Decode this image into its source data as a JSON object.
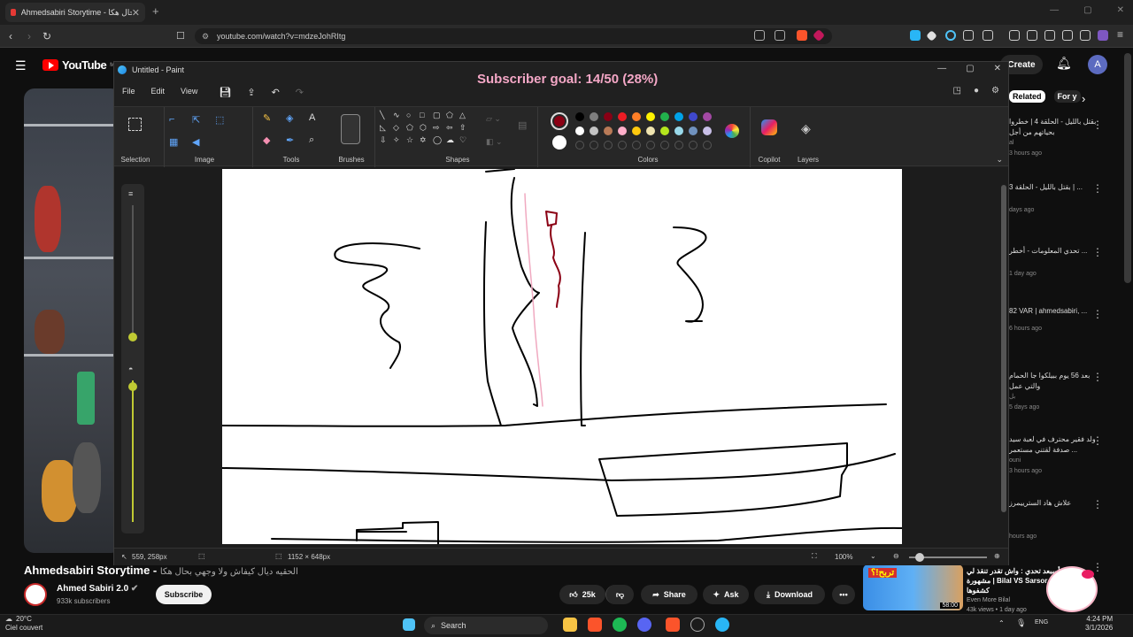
{
  "browser": {
    "tab_title": "Ahmedsabiri Storytime - الحقيه ديال كيفاش ولا وجهي بحال هكا",
    "tab_close": "✕",
    "new_tab": "+",
    "url": "youtube.com/watch?v=mdzeJohRItg",
    "window_controls": [
      "—",
      "▢",
      "✕"
    ]
  },
  "youtube": {
    "logo_text": "YouTube",
    "logo_region": "MA",
    "create_label": "Create",
    "avatar_letter": "A",
    "tabs": [
      "Related",
      "For y"
    ],
    "video_title": "Ahmedsabiri Storytime - ",
    "video_title_ar": "الحقيه ديال كيفاش ولا وجهي بحال هكا",
    "channel_name": "Ahmed Sabiri 2.0",
    "channel_subs": "933k subscribers",
    "subscribe_label": "Subscribe",
    "likes": "25k",
    "share_label": "Share",
    "ask_label": "Ask",
    "download_label": "Download",
    "more_label": "•••",
    "recommendations": [
      {
        "title": "بقتل بالليل - الحلقة 4 | خطروا بحياتهم من أجل",
        "channel": "al",
        "meta": "3 hours ago"
      },
      {
        "title": "بقتل بالليل - الحلقة 3 | ...",
        "channel": "",
        "meta": "days ago"
      },
      {
        "title": "تحدي المعلومات - أخطر ...",
        "channel": "",
        "meta": "1 day ago"
      },
      {
        "title": "82 VAR | ahmedsabiri, ...",
        "channel": "",
        "meta": "6 hours ago"
      },
      {
        "title": "بعد 56 يوم ببيلكوا جا الحمام والتي عمل",
        "channel": "بل",
        "meta": "5 days ago"
      },
      {
        "title": "ولد فقير محترف في لعبة سيد صدفة لقتني مستعمر ...",
        "channel": "ouni",
        "meta": "3 hours ago"
      },
      {
        "title": "علاش هاد السترييمرز",
        "channel": "",
        "meta": "hours ago"
      }
    ],
    "bottom_rec": {
      "title": "أسبعد تحدي : واش تقدر تنقذ لي مشهورة | Bilal VS Sarsor | كشفوها",
      "channel": "Even More Bilal",
      "meta": "43k views • 1 day ago",
      "duration": "58:00",
      "thumb_text": "تربح!؟"
    }
  },
  "paint": {
    "title": "Untitled - Paint",
    "overlay": "Subscriber goal: 14/50 (28%)",
    "menu": [
      "File",
      "Edit",
      "View"
    ],
    "groups": {
      "selection": "Selection",
      "image": "Image",
      "tools": "Tools",
      "brushes": "Brushes",
      "shapes": "Shapes",
      "colors": "Colors",
      "copilot": "Copilot",
      "layers": "Layers"
    },
    "cursor_pos": "559, 258px",
    "canvas_size": "1152 × 648px",
    "zoom": "100%",
    "primary_color": "#8b0014",
    "secondary_color": "#ffffff",
    "palette_row1": [
      "#000000",
      "#7f7f7f",
      "#880015",
      "#ed1c24",
      "#ff7f27",
      "#fff200",
      "#22b14c",
      "#00a2e8",
      "#3f48cc",
      "#a349a4"
    ],
    "palette_row2": [
      "#ffffff",
      "#c3c3c3",
      "#b97a57",
      "#ffaec9",
      "#ffc90e",
      "#efe4b0",
      "#b5e61d",
      "#99d9ea",
      "#7092be",
      "#c8bfe7"
    ]
  },
  "taskbar": {
    "temp": "20°C",
    "weather": "Ciel couvert",
    "search_label": "Search",
    "lang": "ENG",
    "time": "4:24 PM",
    "date": "3/1/2026"
  }
}
